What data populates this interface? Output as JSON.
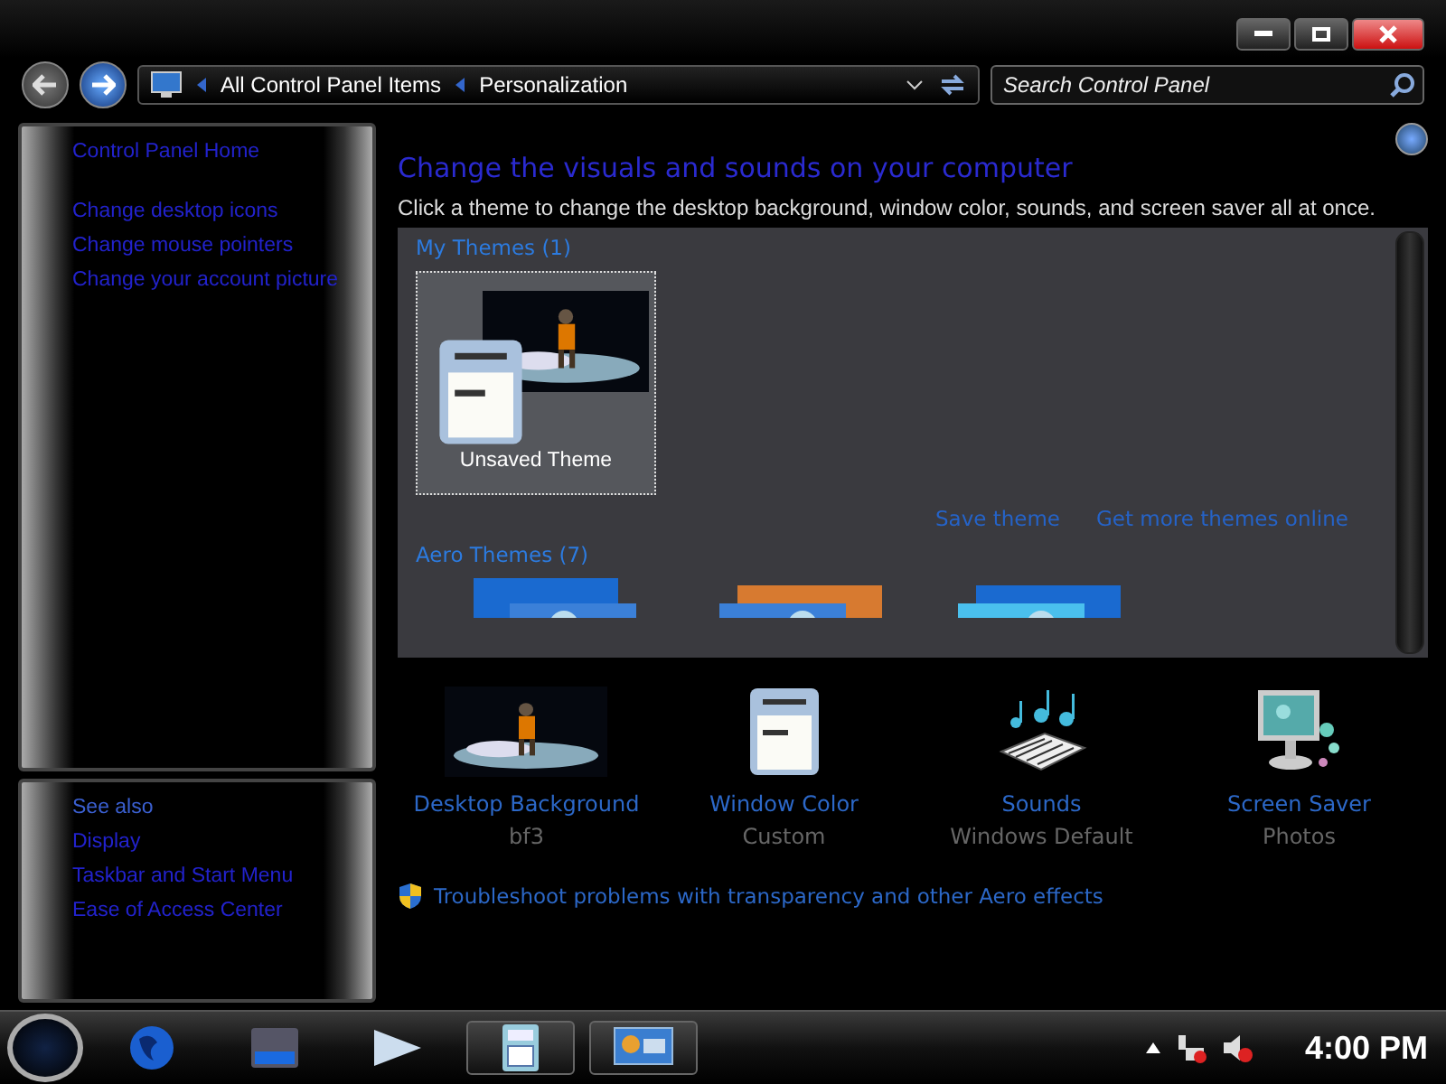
{
  "nav": {
    "breadcrumbs": [
      "All Control Panel Items",
      "Personalization"
    ],
    "search": {
      "placeholder": "Search Control Panel"
    }
  },
  "sidebar": {
    "tasks": [
      "Control Panel Home",
      "Change desktop icons",
      "Change mouse pointers",
      "Change your account picture"
    ],
    "see_also": {
      "heading": "See also",
      "links": [
        "Display",
        "Taskbar and Start Menu",
        "Ease of Access Center"
      ]
    }
  },
  "main": {
    "title": "Change the visuals and sounds on your computer",
    "description": "Click a theme to change the desktop background, window color, sounds, and screen saver all at once.",
    "groups": [
      {
        "title": "My Themes (1)",
        "items": [
          {
            "name": "Unsaved Theme",
            "selected": true
          }
        ]
      },
      {
        "title": "Aero Themes (7)"
      }
    ],
    "actions": [
      "Save theme",
      "Get more themes online"
    ],
    "settings": [
      {
        "kind": "background",
        "label": "Desktop Background",
        "value": "bf3"
      },
      {
        "kind": "window",
        "label": "Window Color",
        "value": "Custom"
      },
      {
        "kind": "sounds",
        "label": "Sounds",
        "value": "Windows Default"
      },
      {
        "kind": "saver",
        "label": "Screen Saver",
        "value": "Photos"
      }
    ],
    "troubleshoot": "Troubleshoot problems with transparency and other Aero effects"
  },
  "taskbar": {
    "apps": [
      {
        "kind": "globe",
        "active": false
      },
      {
        "kind": "drive",
        "active": false
      },
      {
        "kind": "play",
        "active": false
      },
      {
        "kind": "calculator",
        "active": true
      },
      {
        "kind": "panel",
        "active": true
      }
    ],
    "clock": "4:00 PM"
  }
}
